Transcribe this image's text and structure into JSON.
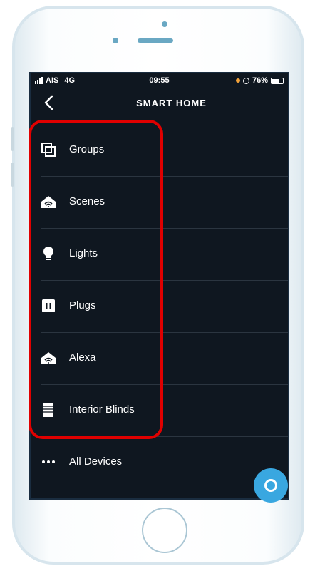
{
  "status_bar": {
    "carrier": "AIS",
    "network": "4G",
    "time": "09:55",
    "battery_text": "76%",
    "battery_level": 0.76
  },
  "header": {
    "title": "SMART HOME"
  },
  "menu": {
    "items": [
      {
        "label": "Groups",
        "icon": "groups-icon"
      },
      {
        "label": "Scenes",
        "icon": "scenes-icon"
      },
      {
        "label": "Lights",
        "icon": "lightbulb-icon"
      },
      {
        "label": "Plugs",
        "icon": "plug-icon"
      },
      {
        "label": "Alexa",
        "icon": "alexa-home-icon"
      },
      {
        "label": "Interior Blinds",
        "icon": "blinds-icon"
      },
      {
        "label": "All Devices",
        "icon": "more-dots-icon"
      }
    ]
  },
  "colors": {
    "screen_bg": "#0f1720",
    "highlight": "#e00000",
    "alexa_blue": "#39a7e0",
    "status_orange": "#f3a23a"
  }
}
